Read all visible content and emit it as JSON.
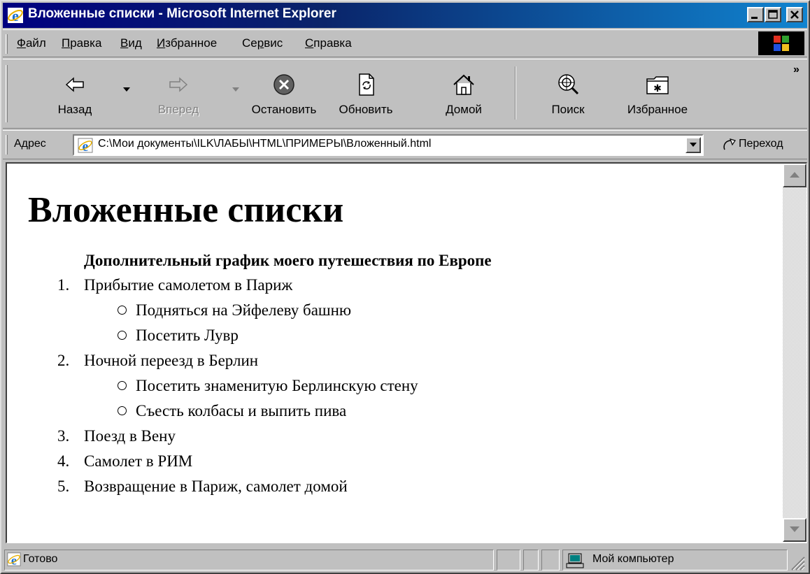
{
  "window": {
    "title": "Вложенные списки - Microsoft Internet Explorer"
  },
  "menu": {
    "items": [
      {
        "accel": "Ф",
        "rest": "айл"
      },
      {
        "accel": "П",
        "rest": "равка"
      },
      {
        "accel": "В",
        "rest": "ид"
      },
      {
        "accel": "И",
        "rest": "збранное"
      },
      {
        "pre": "Се",
        "accel": "р",
        "rest": "вис"
      },
      {
        "accel": "С",
        "rest": "правка"
      }
    ]
  },
  "toolbar": {
    "back": "Назад",
    "forward": "Вперед",
    "stop": "Остановить",
    "refresh": "Обновить",
    "home": "Домой",
    "search": "Поиск",
    "favorites": "Избранное",
    "more": "»"
  },
  "address": {
    "label": "Адрес",
    "value": "C:\\Мои документы\\ILK\\ЛАБЫ\\HTML\\ПРИМЕРЫ\\Вложенный.html",
    "go_label": "Переход"
  },
  "page": {
    "heading": "Вложенные списки",
    "list_caption": "Дополнительный график моего путешествия по Европе",
    "items": [
      {
        "num": "1.",
        "text": "Прибытие самолетом в Париж",
        "sub": [
          "Подняться на Эйфелеву башню",
          "Посетить Лувр"
        ]
      },
      {
        "num": "2.",
        "text": "Ночной переезд в Берлин",
        "sub": [
          "Посетить знаменитую Берлинскую стену",
          "Съесть колбасы и выпить пива"
        ]
      },
      {
        "num": "3.",
        "text": "Поезд в Вену",
        "sub": []
      },
      {
        "num": "4.",
        "text": "Самолет в РИМ",
        "sub": []
      },
      {
        "num": "5.",
        "text": "Возвращение в Париж, самолет домой",
        "sub": []
      }
    ]
  },
  "status": {
    "text": "Готово",
    "zone": "Мой компьютер"
  },
  "colors": {
    "titlebar_start": "#000080",
    "titlebar_end": "#1084d0",
    "chrome": "#c0c0c0"
  }
}
